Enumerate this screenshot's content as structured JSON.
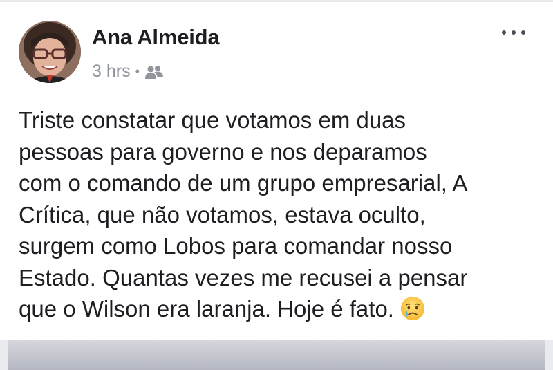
{
  "post": {
    "author": "Ana Almeida",
    "time": "3 hrs",
    "separator": "•",
    "audience_icon": "friends-icon",
    "more_icon": "more-options-icon",
    "text_lines": [
      "Triste constatar que votamos em duas",
      "pessoas para governo e nos deparamos",
      "com o comando de um grupo empresarial, A",
      "Crítica, que não votamos, estava oculto,",
      "surgem como Lobos para comandar nosso",
      "Estado. Quantas vezes me recusei a pensar",
      "que o Wilson era laranja. Hoje é fato."
    ],
    "emoji": "crying-face-emoji"
  },
  "colors": {
    "author_text": "#1c1e21",
    "meta_text": "#90949c",
    "body_text": "#1c1e21",
    "background": "#ffffff"
  }
}
